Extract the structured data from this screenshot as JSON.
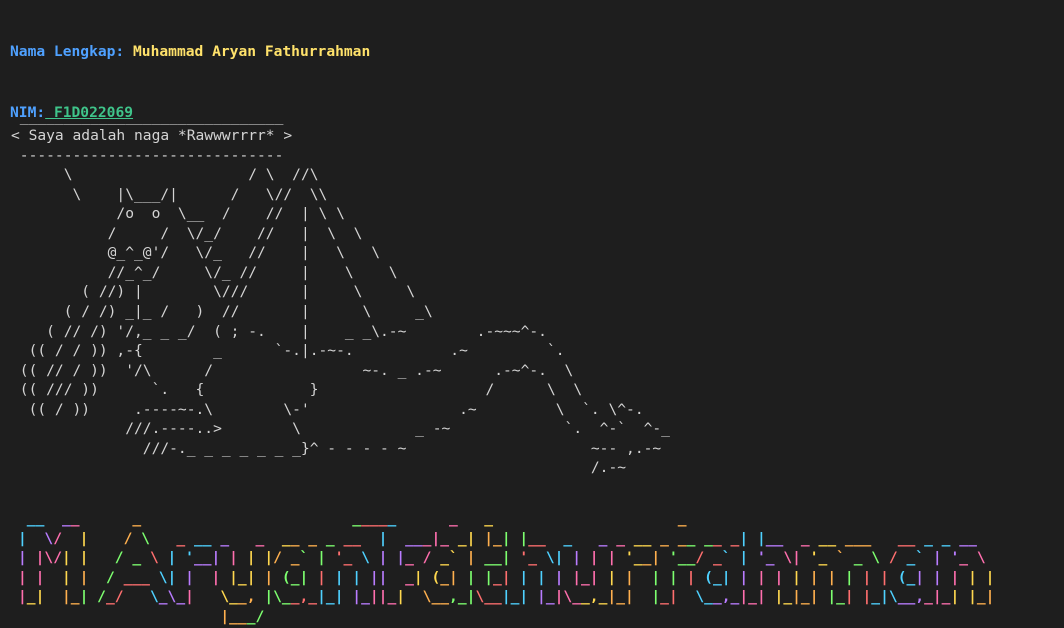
{
  "header": {
    "name_label": "Nama Lengkap:",
    "name_value": " Muhammad Aryan Fathurrahman",
    "nim_label": "NIM:",
    "nim_value": " F1D022069"
  },
  "cowsay": {
    "lines": [
      "",
      " ______________________________",
      "< Saya adalah naga *Rawwwrrrr* >",
      " ------------------------------",
      "      \\                    / \\  //\\",
      "       \\    |\\___/|      /   \\//  \\\\",
      "            /o  o  \\__  /    //  | \\ \\",
      "           /     /  \\/_/    //   |  \\  \\",
      "           @_^_@'/   \\/_   //    |   \\   \\",
      "           //_^_/     \\/_ //     |    \\    \\",
      "        ( //) |        \\///      |     \\     \\",
      "      ( / /) _|_ /   )  //       |      \\     _\\",
      "    ( // /) '/,_ _ _/  ( ; -.    |    _ _\\.-~        .-~~~^-.",
      "  (( / / )) ,-{        _      `-.|.-~-.           .~         `.",
      " (( // / ))  '/\\      /                 ~-. _ .-~      .-~^-.  \\",
      " (( /// ))      `.   {            }                   /      \\  \\",
      "  (( / ))     .----~-.\\        \\-'                 .~         \\  `. \\^-.",
      "             ///.----..>        \\             _ -~             `.  ^-`  ^-_",
      "               ///-._ _ _ _ _ _ _}^ - - - - ~                     ~-- ,.-~",
      "                                                                  /.-~"
    ]
  },
  "banner": {
    "text": "M Aryan Fathurrahman",
    "colors": [
      "#4fd1ff",
      "#b97cff",
      "#ff6fae",
      "#ffd84f",
      "#ffb04f",
      "#7dff6f",
      "#ff6f6f"
    ],
    "lines": [
      " __  __      _                        _____      _   _                     _                             ",
      "|  \\/  |    / \\   _ __ _   _  __ _ _ __  |  ___|_ _| |_| |__  _   _ _ __ _ __ __ _| |__  _ __ ___   __ _ _ __  ",
      "| |\\/| |   / _ \\ | '__| | | |/ _` | '_ \\ | |_ / _` | __| '_ \\| | | | '__| '__/ _` | '_ \\| '_ ` _ \\ / _` | '_ \\ ",
      "| |  | |  / ___ \\| |  | |_| | (_| | | | ||  _| (_| | |_| | | | |_| | |  | | | (_| | | | | | | | | | (_| | | | |",
      "|_|  |_| /_/   \\_\\_|   \\__, |\\__,_|_| |_||_|  \\__,_|\\__|_| |_|\\__,_|_|  |_|  \\__,_|_| |_|_| |_| |_|\\__,_|_| |_|",
      "                       |___/                                                                                      "
    ]
  }
}
